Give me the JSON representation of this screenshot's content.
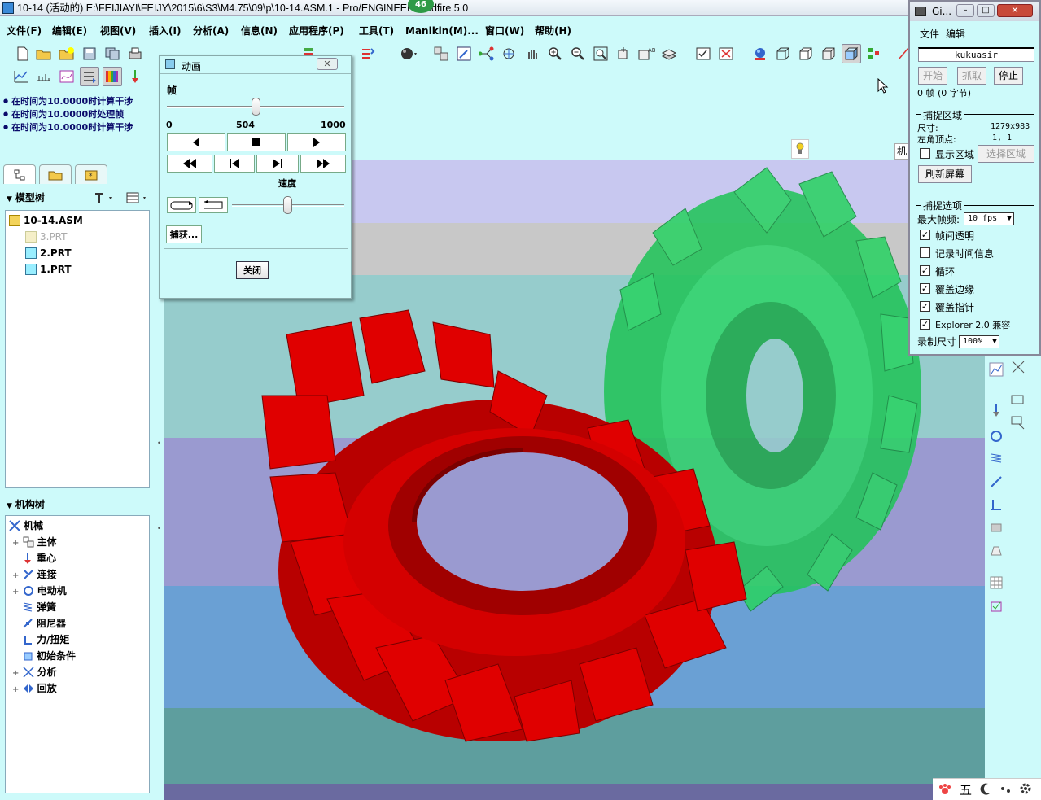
{
  "window": {
    "title": "10-14 (活动的) E:\\FEIJIAYI\\FEIJY\\2015\\6\\S3\\M4.75\\09\\p\\10-14.ASM.1 - Pro/ENGINEER Wildfire 5.0",
    "badge": "46"
  },
  "menu": [
    "文件(F)",
    "编辑(E)",
    "视图(V)",
    "插入(I)",
    "分析(A)",
    "信息(N)",
    "应用程序(P)",
    "工具(T)",
    "Manikin(M)...",
    "窗口(W)",
    "帮助(H)"
  ],
  "messages": [
    "在时间为10.0000时计算干涉",
    "在时间为10.0000时处理帧",
    "在时间为10.0000时计算干涉"
  ],
  "model_tree": {
    "header": "模型树",
    "items": [
      "10-14.ASM",
      "3.PRT",
      "2.PRT",
      "1.PRT"
    ]
  },
  "mechanism_tree": {
    "header": "机构树",
    "items": [
      "机械",
      "主体",
      "重心",
      "连接",
      "电动机",
      "弹簧",
      "阻尼器",
      "力/扭矩",
      "初始条件",
      "分析",
      "回放"
    ]
  },
  "anim_dialog": {
    "title": "动画",
    "frame_label": "帧",
    "frame_min": "0",
    "frame_current": "504",
    "frame_max": "1000",
    "frame_fraction": 0.504,
    "speed_label": "速度",
    "capture_button": "捕获...",
    "close_button": "关闭"
  },
  "gif_recorder": {
    "title": "Gi...",
    "menu": [
      "文件",
      "编辑"
    ],
    "name": "kukuasir",
    "buttons": [
      "开始",
      "抓取",
      "停止"
    ],
    "frame_info": "0 帧 (0 字节)",
    "capture_area_title": "捕捉区域",
    "size_label": "尺寸:",
    "size_value": "1279x983",
    "corner_label": "左角顶点:",
    "corner_value": "1, 1",
    "show_area": "显示区域",
    "select_area": "选择区域",
    "refresh": "刷新屏幕",
    "options_title": "捕捉选项",
    "max_fps_label": "最大帧频:",
    "max_fps_value": "10 fps",
    "checkboxes": [
      {
        "label": "帧间透明",
        "checked": true
      },
      {
        "label": "记录时间信息",
        "checked": false
      },
      {
        "label": "循环",
        "checked": true
      },
      {
        "label": "覆盖边缘",
        "checked": true
      },
      {
        "label": "覆盖指针",
        "checked": true
      },
      {
        "label": "Explorer 2.0 兼容",
        "checked": true
      }
    ],
    "record_size_label": "录制尺寸",
    "record_size_value": "100%"
  },
  "viewport_tag": "机",
  "tray": [
    "五"
  ],
  "colors": {
    "background": "#cdfafa",
    "gear_red": "#d40000",
    "gear_green": "#22c45a",
    "band_lavender": "#c8c8f0",
    "band_gray": "#c8c8c8",
    "band_teal": "#96cccc",
    "band_purple": "#9a9ad0",
    "band_blue": "#6aa0d4",
    "band_bottom": "#5e9e9e"
  }
}
